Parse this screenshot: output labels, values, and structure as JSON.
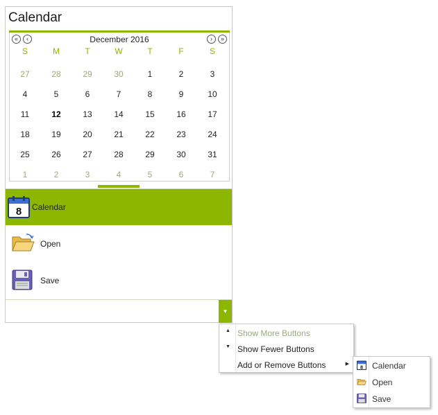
{
  "panel": {
    "title": "Calendar"
  },
  "calendar": {
    "month_label": "December 2016",
    "prev_year_label": "«",
    "prev_month_label": "‹",
    "next_month_label": "›",
    "next_year_label": "»",
    "weekdays": [
      "S",
      "M",
      "T",
      "W",
      "T",
      "F",
      "S"
    ],
    "weeks": [
      [
        "27",
        "28",
        "29",
        "30",
        "1",
        "2",
        "3"
      ],
      [
        "4",
        "5",
        "6",
        "7",
        "8",
        "9",
        "10"
      ],
      [
        "11",
        "12",
        "13",
        "14",
        "15",
        "16",
        "17"
      ],
      [
        "18",
        "19",
        "20",
        "21",
        "22",
        "23",
        "24"
      ],
      [
        "25",
        "26",
        "27",
        "28",
        "29",
        "30",
        "31"
      ],
      [
        "1",
        "2",
        "3",
        "4",
        "5",
        "6",
        "7"
      ]
    ],
    "selected_day": "12"
  },
  "nav": {
    "items": [
      {
        "label": "Calendar",
        "icon": "calendar-icon",
        "selected": true
      },
      {
        "label": "Open",
        "icon": "folder-open-icon",
        "selected": false
      },
      {
        "label": "Save",
        "icon": "floppy-disk-icon",
        "selected": false
      }
    ]
  },
  "overflow": {
    "dropdown_glyph": "▼"
  },
  "context_menu": {
    "items": [
      {
        "label": "Show More Buttons",
        "marker": "▲",
        "enabled": false
      },
      {
        "label": "Show Fewer Buttons",
        "marker": "▼",
        "enabled": true
      },
      {
        "label": "Add or Remove Buttons",
        "marker": "",
        "enabled": true,
        "submenu_arrow": "▶"
      }
    ]
  },
  "submenu": {
    "items": [
      {
        "label": "Calendar",
        "icon": "calendar-icon"
      },
      {
        "label": "Open",
        "icon": "folder-open-icon"
      },
      {
        "label": "Save",
        "icon": "floppy-disk-icon"
      }
    ]
  },
  "colors": {
    "accent": "#8db600",
    "muted_day": "#9aab78",
    "border": "#c8c8c8"
  }
}
